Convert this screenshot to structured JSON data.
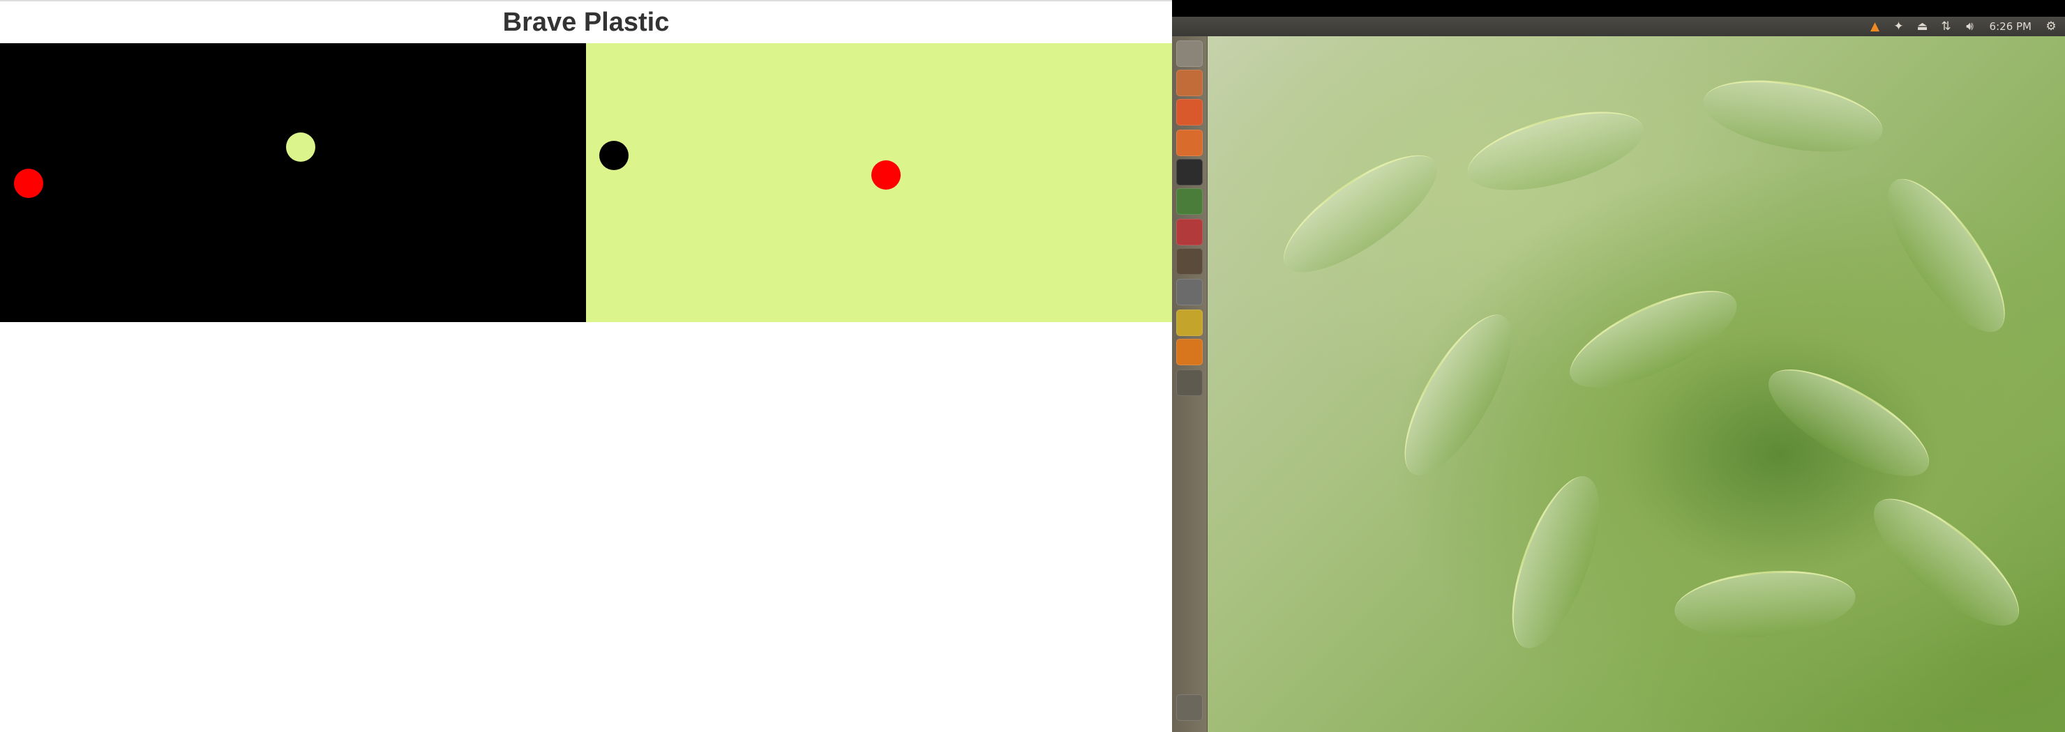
{
  "page": {
    "title": "Brave Plastic",
    "panels": [
      {
        "name": "left",
        "background": "#000000",
        "dots": [
          {
            "color": "#ff0000"
          },
          {
            "color": "#dbf58c"
          }
        ]
      },
      {
        "name": "right",
        "background": "#dbf58c",
        "dots": [
          {
            "color": "#000000"
          },
          {
            "color": "#ff0000"
          }
        ]
      }
    ]
  },
  "desktop": {
    "clock": "6:26 PM",
    "tray_icons": [
      "vlc-icon",
      "dropbox-icon",
      "transfer-icon",
      "network-icon",
      "volume-icon"
    ],
    "settings_icon": "gear-icon",
    "launcher_items": [
      {
        "name": "dash-home-icon",
        "color": "#8a8479"
      },
      {
        "name": "files-icon",
        "color": "#c26c3a"
      },
      {
        "name": "firefox-icon",
        "color": "#d9582c"
      },
      {
        "name": "software-center-icon",
        "color": "#d96b2c"
      },
      {
        "name": "terminal-icon",
        "color": "#2d2d2d"
      },
      {
        "name": "app-green-icon",
        "color": "#4b7d3a"
      },
      {
        "name": "downloader-icon",
        "color": "#b23a3a"
      },
      {
        "name": "sublime-text-icon",
        "color": "#5a4b3a"
      },
      {
        "name": "chrome-icon",
        "color": "#6b6b6b"
      },
      {
        "name": "folder-yellow-icon",
        "color": "#c4a42a"
      },
      {
        "name": "vlc-launcher-icon",
        "color": "#d8761e"
      },
      {
        "name": "window-app-icon",
        "color": "#5f5a50"
      },
      {
        "name": "trash-icon",
        "color": "#6c675c"
      }
    ]
  }
}
